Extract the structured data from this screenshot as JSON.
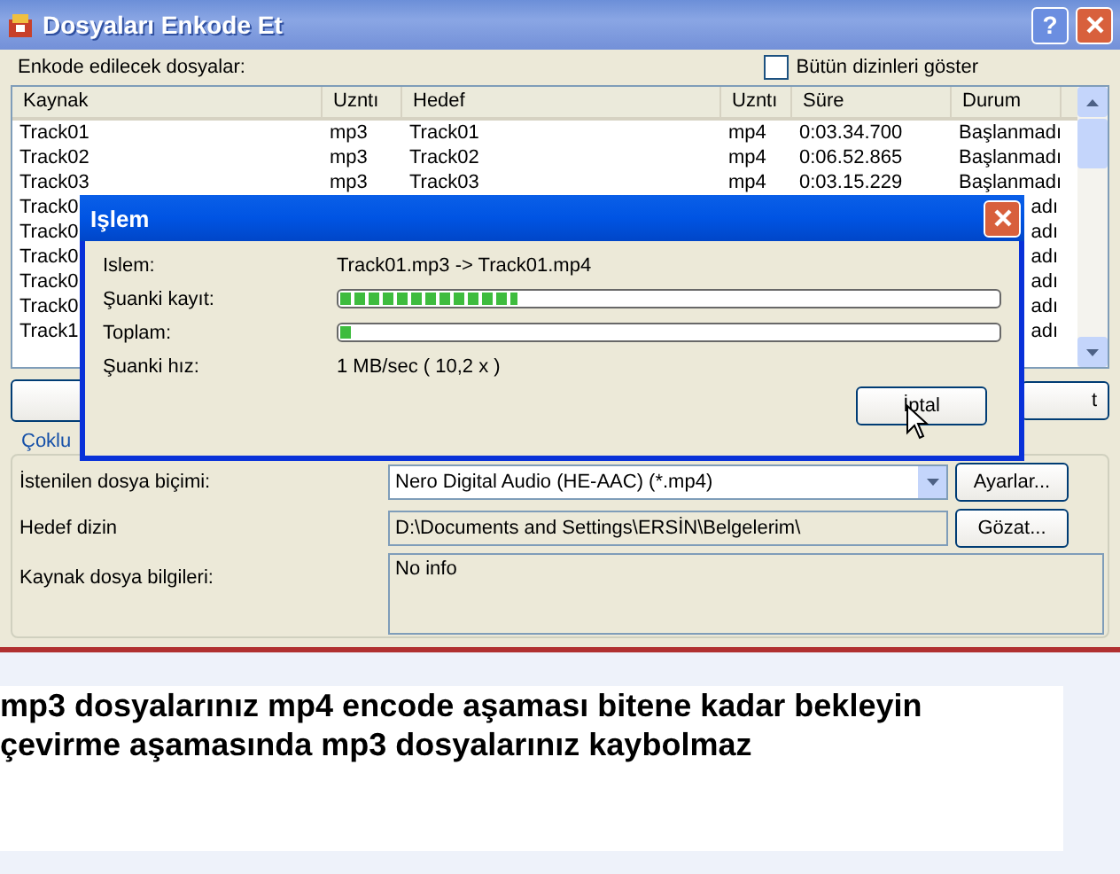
{
  "window": {
    "title": "Dosyaları Enkode Et",
    "help_button": "?"
  },
  "file_list": {
    "label": "Enkode edilecek dosyalar:",
    "show_all": {
      "label": "Bütün dizinleri göster",
      "checked": false
    },
    "columns": [
      "Kaynak",
      "Uzntı",
      "Hedef",
      "Uzntı",
      "Süre",
      "Durum"
    ],
    "rows": [
      {
        "kaynak": "Track01",
        "ext1": "mp3",
        "hedef": "Track01",
        "ext2": "mp4",
        "sure": "0:03.34.700",
        "durum": "Başlanmadı"
      },
      {
        "kaynak": "Track02",
        "ext1": "mp3",
        "hedef": "Track02",
        "ext2": "mp4",
        "sure": "0:06.52.865",
        "durum": "Başlanmadı"
      },
      {
        "kaynak": "Track03",
        "ext1": "mp3",
        "hedef": "Track03",
        "ext2": "mp4",
        "sure": "0:03.15.229",
        "durum": "Başlanmadı"
      },
      {
        "kaynak": "Track0",
        "durum": "adı"
      },
      {
        "kaynak": "Track0",
        "durum": "adı"
      },
      {
        "kaynak": "Track0",
        "durum": "adı"
      },
      {
        "kaynak": "Track0",
        "durum": "adı"
      },
      {
        "kaynak": "Track0",
        "durum": "adı"
      },
      {
        "kaynak": "Track1",
        "durum": "adı"
      }
    ]
  },
  "right_button": "t",
  "options": {
    "tab": "Çoklu",
    "format": {
      "label": "İstenilen dosya biçimi:",
      "value": "Nero Digital Audio (HE-AAC) (*.mp4)",
      "button": "Ayarlar..."
    },
    "target": {
      "label": "Hedef dizin",
      "value": "D:\\Documents and Settings\\ERSİN\\Belgelerim\\",
      "button": "Gözat..."
    },
    "info": {
      "label": "Kaynak dosya bilgileri:",
      "value": "No info"
    }
  },
  "progress_dialog": {
    "title": "Işlem",
    "rows": [
      {
        "kind": "text",
        "label": "Islem:",
        "value": "Track01.mp3 -> Track01.mp4"
      },
      {
        "kind": "bar",
        "label": "Şuanki kayıt:",
        "level": 0.27
      },
      {
        "kind": "bar",
        "label": "Toplam:",
        "level": 0.02
      },
      {
        "kind": "text",
        "label": "Şuanki hız:",
        "value": "1 MB/sec ( 10,2 x )"
      }
    ],
    "cancel": "İptal"
  },
  "caption": {
    "lines": [
      "mp3 dosyalarınız mp4 encode aşaması bitene kadar bekleyin",
      "çevirme aşamasında mp3 dosyalarınız kaybolmaz"
    ]
  }
}
